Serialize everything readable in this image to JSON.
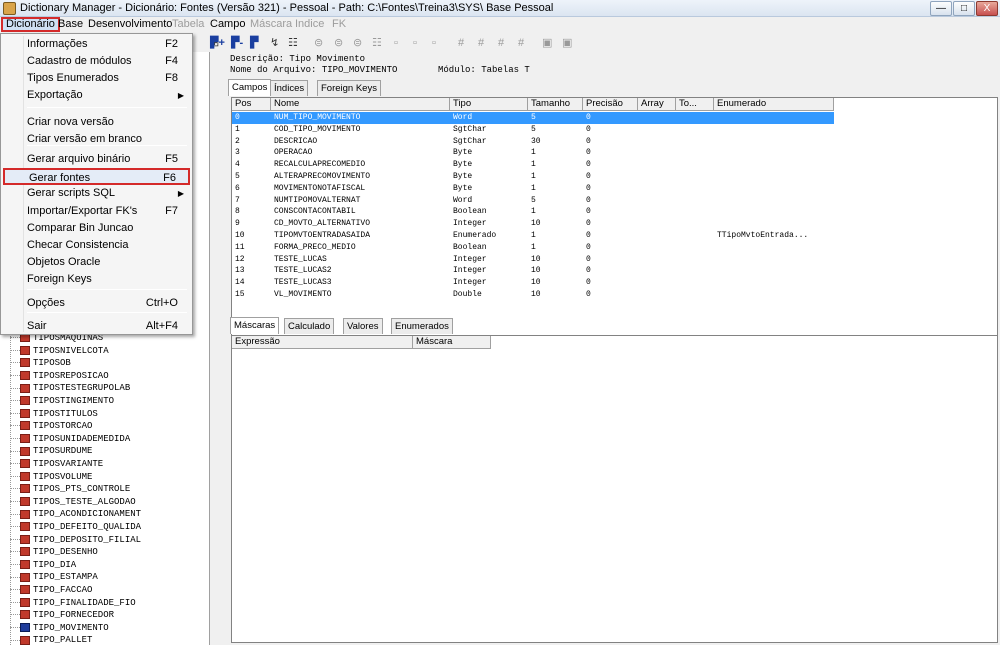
{
  "window": {
    "title": "Dictionary Manager - Dicionário: Fontes (Versão 321) - Pessoal - Path: C:\\Fontes\\Treina3\\SYS\\ Base Pessoal",
    "min_label": "—",
    "max_label": "□",
    "close_label": "X"
  },
  "menubar": {
    "dicionario": "Dicionário",
    "base": "Base",
    "desenvolvimento": "Desenvolvimento",
    "tabela": "Tabela",
    "campo": "Campo",
    "mascara": "Máscara",
    "indice": "Indice",
    "fk": "FK"
  },
  "toolbar": {
    "b1": "⊞",
    "b2": "▛+",
    "b3": "▛-",
    "b4": "▛",
    "b5": "↯",
    "b6": "☷",
    "b7": "⊜",
    "b8": "⊜",
    "b9": "⊜",
    "b10": "☷",
    "b11": "▫",
    "b12": "▫",
    "b13": "▫",
    "b14": "#",
    "b15": "#",
    "b16": "#",
    "b17": "#",
    "b18": "▣",
    "b19": "▣"
  },
  "dropdown": {
    "items": [
      {
        "label": "Informações",
        "shortcut": "F2"
      },
      {
        "label": "Cadastro de módulos",
        "shortcut": "F4"
      },
      {
        "label": "Tipos Enumerados",
        "shortcut": "F8"
      },
      {
        "label": "Exportação",
        "shortcut": ""
      },
      {
        "label": "Criar nova versão",
        "shortcut": ""
      },
      {
        "label": "Criar versão em branco",
        "shortcut": ""
      },
      {
        "label": "Gerar arquivo binário",
        "shortcut": "F5"
      },
      {
        "label": "Gerar fontes",
        "shortcut": "F6"
      },
      {
        "label": "Gerar scripts SQL",
        "shortcut": ""
      },
      {
        "label": "Importar/Exportar FK's",
        "shortcut": "F7"
      },
      {
        "label": "Comparar Bin Juncao",
        "shortcut": ""
      },
      {
        "label": "Checar Consistencia",
        "shortcut": ""
      },
      {
        "label": "Objetos Oracle",
        "shortcut": ""
      },
      {
        "label": "Foreign Keys",
        "shortcut": ""
      },
      {
        "label": "Opções",
        "shortcut": "Ctrl+O"
      },
      {
        "label": "Sair",
        "shortcut": "Alt+F4"
      }
    ],
    "submenu_arrow": "▶"
  },
  "tree": {
    "items": [
      "TIPOSMAQUINAS",
      "TIPOSNIVELCOTA",
      "TIPOSOB",
      "TIPOSREPOSICAO",
      "TIPOSTESTEGRUPOLAB",
      "TIPOSTINGIMENTO",
      "TIPOSTITULOS",
      "TIPOSTORCAO",
      "TIPOSUNIDADEMEDIDA",
      "TIPOSURDUME",
      "TIPOSVARIANTE",
      "TIPOSVOLUME",
      "TIPOS_PTS_CONTROLE",
      "TIPOS_TESTE_ALGODAO",
      "TIPO_ACONDICIONAMENT",
      "TIPO_DEFEITO_QUALIDA",
      "TIPO_DEPOSITO_FILIAL",
      "TIPO_DESENHO",
      "TIPO_DIA",
      "TIPO_ESTAMPA",
      "TIPO_FACCAO",
      "TIPO_FINALIDADE_FIO",
      "TIPO_FORNECEDOR",
      "TIPO_MOVIMENTO",
      "TIPO_PALLET"
    ],
    "selected": "TIPO_MOVIMENTO"
  },
  "info": {
    "descricao": "Descrição: Tipo Movimento",
    "arquivo": "Nome do Arquivo: TIPO_MOVIMENTO",
    "modulo": "Módulo: Tabelas T"
  },
  "top_tabs": [
    "Campos",
    "Índices",
    "Foreign Keys"
  ],
  "fields_grid": {
    "columns": [
      "Pos",
      "Nome",
      "Tipo",
      "Tamanho",
      "Precisão",
      "Array",
      "To...",
      "Enumerado"
    ],
    "rows": [
      [
        "0",
        "NUM_TIPO_MOVIMENTO",
        "Word",
        "5",
        "0",
        "",
        ""
      ],
      [
        "1",
        "COD_TIPO_MOVIMENTO",
        "SgtChar",
        "5",
        "0",
        "",
        ""
      ],
      [
        "2",
        "DESCRICAO",
        "SgtChar",
        "30",
        "0",
        "",
        ""
      ],
      [
        "3",
        "OPERACAO",
        "Byte",
        "1",
        "0",
        "",
        ""
      ],
      [
        "4",
        "RECALCULAPRECOMEDIO",
        "Byte",
        "1",
        "0",
        "",
        ""
      ],
      [
        "5",
        "ALTERAPRECOMOVIMENTO",
        "Byte",
        "1",
        "0",
        "",
        ""
      ],
      [
        "6",
        "MOVIMENTONOTAFISCAL",
        "Byte",
        "1",
        "0",
        "",
        ""
      ],
      [
        "7",
        "NUMTIPOMOVALTERNAT",
        "Word",
        "5",
        "0",
        "",
        ""
      ],
      [
        "8",
        "CONSCONTACONTABIL",
        "Boolean",
        "1",
        "0",
        "",
        ""
      ],
      [
        "9",
        "CD_MOVTO_ALTERNATIVO",
        "Integer",
        "10",
        "0",
        "",
        ""
      ],
      [
        "10",
        "TIPOMVTOENTRADASAIDA",
        "Enumerado",
        "1",
        "0",
        "",
        "TTipoMvtoEntrada..."
      ],
      [
        "11",
        "FORMA_PRECO_MEDIO",
        "Boolean",
        "1",
        "0",
        "",
        ""
      ],
      [
        "12",
        "TESTE_LUCAS",
        "Integer",
        "10",
        "0",
        "",
        ""
      ],
      [
        "13",
        "TESTE_LUCAS2",
        "Integer",
        "10",
        "0",
        "",
        ""
      ],
      [
        "14",
        "TESTE_LUCAS3",
        "Integer",
        "10",
        "0",
        "",
        ""
      ],
      [
        "15",
        "VL_MOVIMENTO",
        "Double",
        "10",
        "0",
        "",
        ""
      ]
    ]
  },
  "bottom_tabs": [
    "Máscaras",
    "Calculado",
    "Valores",
    "Enumerados"
  ],
  "mask_grid": {
    "columns": [
      "Expressão",
      "Máscara"
    ]
  }
}
